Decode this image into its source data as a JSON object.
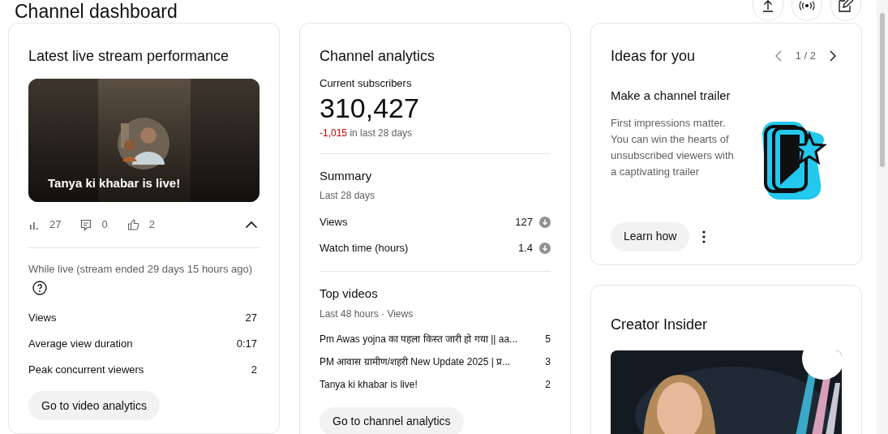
{
  "header": {
    "title": "Channel dashboard"
  },
  "live_stream": {
    "title": "Latest live stream performance",
    "video_title": "Tanya ki khabar is live!",
    "stats": [
      {
        "kind": "views",
        "value": "27"
      },
      {
        "kind": "comments",
        "value": "0"
      },
      {
        "kind": "likes",
        "value": "2"
      }
    ],
    "expanded": true,
    "period": "While live (stream ended 29 days 15 hours ago)",
    "metrics": [
      {
        "label": "Views",
        "value": "27"
      },
      {
        "label": "Average view duration",
        "value": "0:17"
      },
      {
        "label": "Peak concurrent viewers",
        "value": "2"
      }
    ],
    "button": "Go to video analytics"
  },
  "channel_analytics": {
    "title": "Channel analytics",
    "subscribers_label": "Current subscribers",
    "subscribers": "310,427",
    "change": "-1,015",
    "change_suffix": "in last 28 days",
    "summary": {
      "title": "Summary",
      "period": "Last 28 days",
      "metrics": [
        {
          "label": "Views",
          "value": "127",
          "kind": "decrease"
        },
        {
          "label": "Watch time (hours)",
          "value": "1.4",
          "kind": "decrease"
        }
      ]
    },
    "top_videos": {
      "title": "Top videos",
      "period": "Last 48 hours · Views",
      "videos": [
        {
          "title": "Pm Awas yojna का पहला किस्त जारी हो गया || aa...",
          "views": "5"
        },
        {
          "title": "PM आवास ग्रामीण/शहरी New Update 2025 | प्र...",
          "views": "3"
        },
        {
          "title": "Tanya ki khabar is live!",
          "views": "2"
        }
      ]
    },
    "button": "Go to channel analytics"
  },
  "ideas": {
    "title": "Ideas for you",
    "pager": "1 / 2",
    "idea_title": "Make a channel trailer",
    "description": "First impressions matter. You can win the hearts of unsubscribed viewers with a captivating trailer",
    "button": "Learn how"
  },
  "creator_insider": {
    "title": "Creator Insider"
  }
}
